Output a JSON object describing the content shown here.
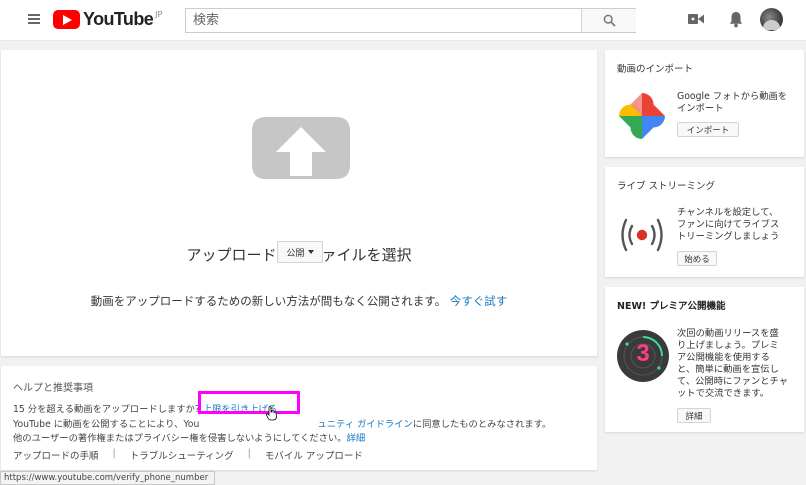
{
  "masthead": {
    "logo_text": "YouTube",
    "region": "JP",
    "search_placeholder": "検索"
  },
  "upload": {
    "title": "アップロードするファイルを選択",
    "privacy_label": "公開",
    "note": "動画をアップロードするための新しい方法が間もなく公開されます。",
    "try_now": "今すぐ試す"
  },
  "help": {
    "title": "ヘルプと推奨事項",
    "line1_prefix": "15 分を超える動画をアップロードしますか",
    "line1_qmark": "?",
    "line1_link": "上限を引き上げる",
    "line2_prefix": "YouTube に動画を公開することにより、You",
    "line2_mid": "ュニティ ガイドライン",
    "line2_suffix": "に同意したものとみなされます。",
    "line3": "他のユーザーの著作権またはプライバシー権を侵害しないようにしてください。",
    "line3_link": "詳細",
    "links": [
      "アップロードの手順",
      "トラブルシューティング",
      "モバイル アップロード"
    ]
  },
  "sidebar": {
    "import": {
      "title": "動画のインポート",
      "desc": [
        "Google フォトから動画を",
        "インポート"
      ],
      "button": "インポート"
    },
    "live": {
      "title": "ライブ ストリーミング",
      "desc": [
        "チャンネルを設定して、",
        "ファンに向けてライブス",
        "トリーミングしましょう"
      ],
      "button": "始める"
    },
    "premiere": {
      "title": "NEW! プレミア公開機能",
      "desc": [
        "次回の動画リリースを盛",
        "り上げましょう。プレミ",
        "ア公開機能を使用する",
        "と、簡単に動画を宣伝し",
        "て、公開時にファンとチャ",
        "ットで交流できます。"
      ],
      "button": "詳細",
      "badge_number": "3"
    }
  },
  "status_bar": "https://www.youtube.com/verify_phone_number",
  "colors": {
    "brand_red": "#ff0000",
    "link_blue": "#167ac6",
    "highlight_magenta": "#ff00ff"
  }
}
